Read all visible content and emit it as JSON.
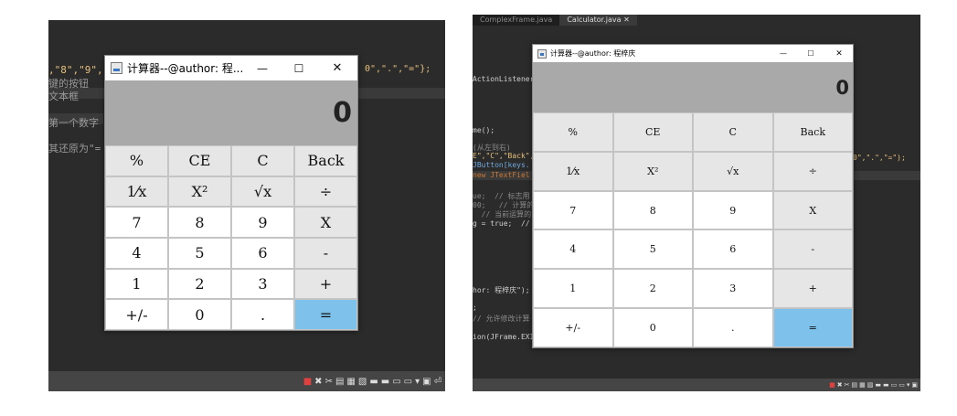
{
  "left": {
    "code_lines": [
      {
        "text": ",\"8\",\"9\",",
        "color": "#e6c07b"
      },
      {
        "text": "键的按钮",
        "color": "#9a9a9a"
      },
      {
        "text": "文本框",
        "color": "#9a9a9a"
      },
      {
        "text": "第一个数字",
        "color": "#9a9a9a"
      },
      {
        "text": "其还原为\"=",
        "color": "#9a9a9a"
      }
    ],
    "code_right": "0\",\".\",\"=\"};",
    "calc": {
      "title": "计算器--@author: 程...",
      "display": "0",
      "window_buttons": [
        "—",
        "☐",
        "✕"
      ],
      "keys": [
        [
          "%",
          "CE",
          "C",
          "Back"
        ],
        [
          "1⁄x",
          "X²",
          "√x",
          "÷"
        ],
        [
          "7",
          "8",
          "9",
          "X"
        ],
        [
          "4",
          "5",
          "6",
          "-"
        ],
        [
          "1",
          "2",
          "3",
          "+"
        ],
        [
          "+/-",
          "0",
          ".",
          "="
        ]
      ]
    },
    "status_icons": [
      "■",
      "✖",
      "✂",
      "▤",
      "▦",
      "▧",
      "▬",
      "▬",
      "▭",
      "▭",
      "▾",
      "▣",
      "⏎"
    ]
  },
  "right": {
    "tabs": [
      "ComplexFrame.java",
      "Calculator.java ✕"
    ],
    "code_lines": [
      {
        "text": "ActionListener",
        "color": "#cfcfcf"
      },
      {
        "text": "me();",
        "color": "#cfcfcf"
      },
      {
        "text": "(从左到右)",
        "color": "#8a8a8a"
      },
      {
        "text": "E\",\"C\",\"Back\",",
        "color": "#e6c07b"
      },
      {
        "text": "JButton[keys.",
        "color": "#6fa8dc"
      },
      {
        "text": "new JTextFiel",
        "color": "#cc7832"
      },
      {
        "text": "ue;  // 标志用",
        "color": "#8a8a8a"
      },
      {
        "text": "00;   // 计算的",
        "color": "#8a8a8a"
      },
      {
        "text": "  // 当前运算的",
        "color": "#8a8a8a"
      },
      {
        "text": "g = true;  //",
        "color": "#cfcfcf"
      },
      {
        "text": "hor: 程梓庆\");",
        "color": "#cfcfcf"
      },
      {
        "text": ";",
        "color": "#cfcfcf"
      },
      {
        "text": "// 允许修改计算",
        "color": "#8a8a8a"
      },
      {
        "text": "ion(JFrame.EXI",
        "color": "#cfcfcf"
      }
    ],
    "code_right": "0\",\".\",\"=\");",
    "calc": {
      "title": "计算器--@author: 程梓庆",
      "display": "0",
      "window_buttons": [
        "—",
        "☐",
        "✕"
      ],
      "keys": [
        [
          "%",
          "CE",
          "C",
          "Back"
        ],
        [
          "1⁄x",
          "X²",
          "√x",
          "÷"
        ],
        [
          "7",
          "8",
          "9",
          "X"
        ],
        [
          "4",
          "5",
          "6",
          "-"
        ],
        [
          "1",
          "2",
          "3",
          "+"
        ],
        [
          "+/-",
          "0",
          ".",
          "="
        ]
      ]
    },
    "status_icons": [
      "■",
      "✖",
      "✂",
      "▤",
      "▦",
      "▧",
      "▬",
      "▬",
      "▭",
      "▭",
      "▾",
      "▣"
    ]
  },
  "colors": {
    "key_gray": "#e6e6e6",
    "key_white": "#ffffff",
    "key_equals": "#7ec2ec",
    "display_bg": "#a9a9a9",
    "ide_bg": "#2b2b2b",
    "statusbar_bg": "#454545"
  }
}
